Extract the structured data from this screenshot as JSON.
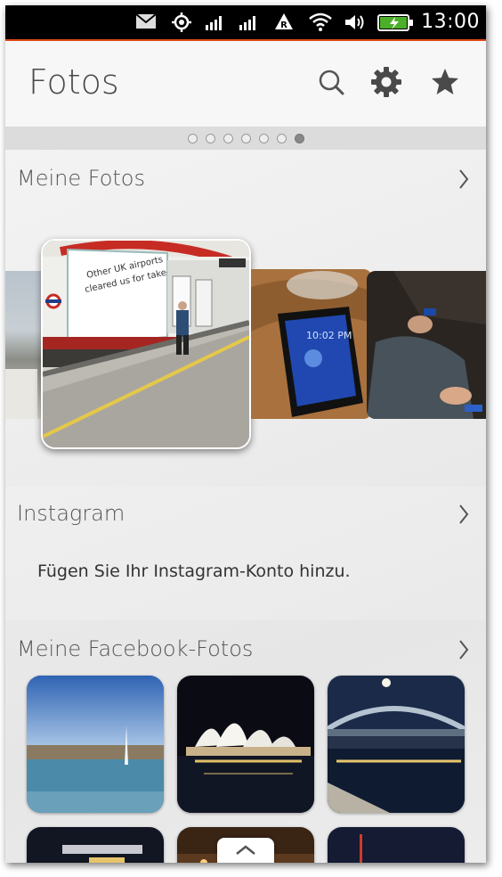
{
  "status_bar": {
    "time": "13:00",
    "icons": [
      "mail-icon",
      "location-icon",
      "signal-icon",
      "signal-icon",
      "roaming-icon",
      "wifi-icon",
      "volume-icon",
      "battery-charging-icon"
    ]
  },
  "header": {
    "title": "Fotos",
    "actions": [
      "search-icon",
      "settings-icon",
      "favorite-star-icon"
    ]
  },
  "page_indicator": {
    "count": 7,
    "active_index": 6
  },
  "sections": {
    "my_photos": {
      "label": "Meine Fotos"
    },
    "instagram": {
      "label": "Instagram",
      "hint": "Fügen Sie Ihr Instagram-Konto hinzu."
    },
    "facebook": {
      "label": "Meine Facebook-Fotos"
    }
  },
  "colors": {
    "accent": "#dd4814",
    "text": "#4a4a4a"
  }
}
